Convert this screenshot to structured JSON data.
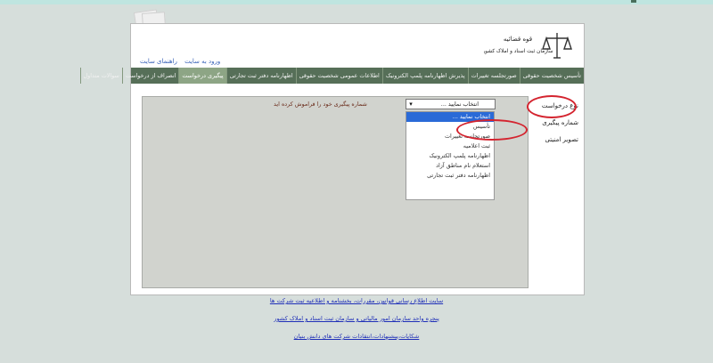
{
  "header": {
    "logo_text_line1": "قوه قضائیه",
    "logo_text_line2": "سازمان ثبت اسناد و املاک کشور",
    "links": [
      "ورود به سایت",
      "راهنمای سایت"
    ]
  },
  "nav": {
    "items": [
      {
        "label": "تأسیس شخصیت حقوقی"
      },
      {
        "label": "صورتجلسه تغییرات"
      },
      {
        "label": "پذیرش اظهارنامه پلمپ الکترونیک"
      },
      {
        "label": "اطلاعات عمومی شخصیت حقوقی"
      },
      {
        "label": "اظهارنامه دفتر ثبت تجارتی"
      },
      {
        "label": "پیگیری درخواست"
      },
      {
        "label": "انصراف از درخواست"
      },
      {
        "label": "سوالات متداول"
      }
    ]
  },
  "side_menu": {
    "items": [
      {
        "label": "نوع درخواست"
      },
      {
        "label": "شماره پیگیری"
      },
      {
        "label": "تصویر امنیتی"
      }
    ]
  },
  "form": {
    "select_value": "انتخاب نمایید ...",
    "forgot_text": "شماره پیگیری خود را فراموش کرده اید",
    "dropdown_options": [
      "انتخاب نمایید ...",
      "تأسیس",
      "صورتجلسه تغییرات",
      "ثبت اعلامیه",
      "اظهارنامه پلمپ الکترونیک",
      "استعلام نام مناطق آزاد",
      "اظهارنامه دفتر ثبت تجارتی"
    ]
  },
  "footer": {
    "links": [
      "سایت اطلاع رسانی قوانین، مقررات، بخشنامه و اطلاعیه ثبت شرکت ها",
      "پنجره واحد سازمان امور مالیاتی و سازمان ثبت اسناد و املاک کشور",
      "شکایات،پیشنهادات،انتقادات شرکت های دانش بنیان"
    ]
  },
  "colors": {
    "nav_bg": "#566f58",
    "nav_active": "#8da585",
    "highlight": "#2a6ad7",
    "circle": "#d4242f"
  }
}
